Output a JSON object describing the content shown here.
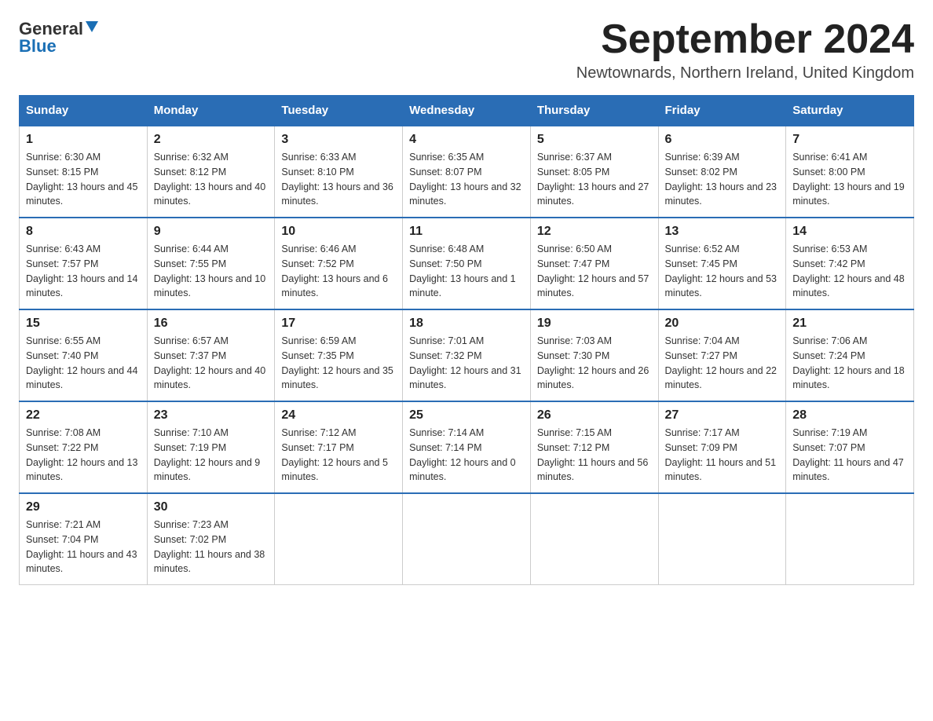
{
  "header": {
    "logo_line1": "General",
    "logo_line2": "Blue",
    "month_title": "September 2024",
    "subtitle": "Newtownards, Northern Ireland, United Kingdom"
  },
  "calendar": {
    "days_of_week": [
      "Sunday",
      "Monday",
      "Tuesday",
      "Wednesday",
      "Thursday",
      "Friday",
      "Saturday"
    ],
    "weeks": [
      [
        {
          "day": "1",
          "sunrise": "6:30 AM",
          "sunset": "8:15 PM",
          "daylight": "13 hours and 45 minutes."
        },
        {
          "day": "2",
          "sunrise": "6:32 AM",
          "sunset": "8:12 PM",
          "daylight": "13 hours and 40 minutes."
        },
        {
          "day": "3",
          "sunrise": "6:33 AM",
          "sunset": "8:10 PM",
          "daylight": "13 hours and 36 minutes."
        },
        {
          "day": "4",
          "sunrise": "6:35 AM",
          "sunset": "8:07 PM",
          "daylight": "13 hours and 32 minutes."
        },
        {
          "day": "5",
          "sunrise": "6:37 AM",
          "sunset": "8:05 PM",
          "daylight": "13 hours and 27 minutes."
        },
        {
          "day": "6",
          "sunrise": "6:39 AM",
          "sunset": "8:02 PM",
          "daylight": "13 hours and 23 minutes."
        },
        {
          "day": "7",
          "sunrise": "6:41 AM",
          "sunset": "8:00 PM",
          "daylight": "13 hours and 19 minutes."
        }
      ],
      [
        {
          "day": "8",
          "sunrise": "6:43 AM",
          "sunset": "7:57 PM",
          "daylight": "13 hours and 14 minutes."
        },
        {
          "day": "9",
          "sunrise": "6:44 AM",
          "sunset": "7:55 PM",
          "daylight": "13 hours and 10 minutes."
        },
        {
          "day": "10",
          "sunrise": "6:46 AM",
          "sunset": "7:52 PM",
          "daylight": "13 hours and 6 minutes."
        },
        {
          "day": "11",
          "sunrise": "6:48 AM",
          "sunset": "7:50 PM",
          "daylight": "13 hours and 1 minute."
        },
        {
          "day": "12",
          "sunrise": "6:50 AM",
          "sunset": "7:47 PM",
          "daylight": "12 hours and 57 minutes."
        },
        {
          "day": "13",
          "sunrise": "6:52 AM",
          "sunset": "7:45 PM",
          "daylight": "12 hours and 53 minutes."
        },
        {
          "day": "14",
          "sunrise": "6:53 AM",
          "sunset": "7:42 PM",
          "daylight": "12 hours and 48 minutes."
        }
      ],
      [
        {
          "day": "15",
          "sunrise": "6:55 AM",
          "sunset": "7:40 PM",
          "daylight": "12 hours and 44 minutes."
        },
        {
          "day": "16",
          "sunrise": "6:57 AM",
          "sunset": "7:37 PM",
          "daylight": "12 hours and 40 minutes."
        },
        {
          "day": "17",
          "sunrise": "6:59 AM",
          "sunset": "7:35 PM",
          "daylight": "12 hours and 35 minutes."
        },
        {
          "day": "18",
          "sunrise": "7:01 AM",
          "sunset": "7:32 PM",
          "daylight": "12 hours and 31 minutes."
        },
        {
          "day": "19",
          "sunrise": "7:03 AM",
          "sunset": "7:30 PM",
          "daylight": "12 hours and 26 minutes."
        },
        {
          "day": "20",
          "sunrise": "7:04 AM",
          "sunset": "7:27 PM",
          "daylight": "12 hours and 22 minutes."
        },
        {
          "day": "21",
          "sunrise": "7:06 AM",
          "sunset": "7:24 PM",
          "daylight": "12 hours and 18 minutes."
        }
      ],
      [
        {
          "day": "22",
          "sunrise": "7:08 AM",
          "sunset": "7:22 PM",
          "daylight": "12 hours and 13 minutes."
        },
        {
          "day": "23",
          "sunrise": "7:10 AM",
          "sunset": "7:19 PM",
          "daylight": "12 hours and 9 minutes."
        },
        {
          "day": "24",
          "sunrise": "7:12 AM",
          "sunset": "7:17 PM",
          "daylight": "12 hours and 5 minutes."
        },
        {
          "day": "25",
          "sunrise": "7:14 AM",
          "sunset": "7:14 PM",
          "daylight": "12 hours and 0 minutes."
        },
        {
          "day": "26",
          "sunrise": "7:15 AM",
          "sunset": "7:12 PM",
          "daylight": "11 hours and 56 minutes."
        },
        {
          "day": "27",
          "sunrise": "7:17 AM",
          "sunset": "7:09 PM",
          "daylight": "11 hours and 51 minutes."
        },
        {
          "day": "28",
          "sunrise": "7:19 AM",
          "sunset": "7:07 PM",
          "daylight": "11 hours and 47 minutes."
        }
      ],
      [
        {
          "day": "29",
          "sunrise": "7:21 AM",
          "sunset": "7:04 PM",
          "daylight": "11 hours and 43 minutes."
        },
        {
          "day": "30",
          "sunrise": "7:23 AM",
          "sunset": "7:02 PM",
          "daylight": "11 hours and 38 minutes."
        },
        null,
        null,
        null,
        null,
        null
      ]
    ]
  }
}
